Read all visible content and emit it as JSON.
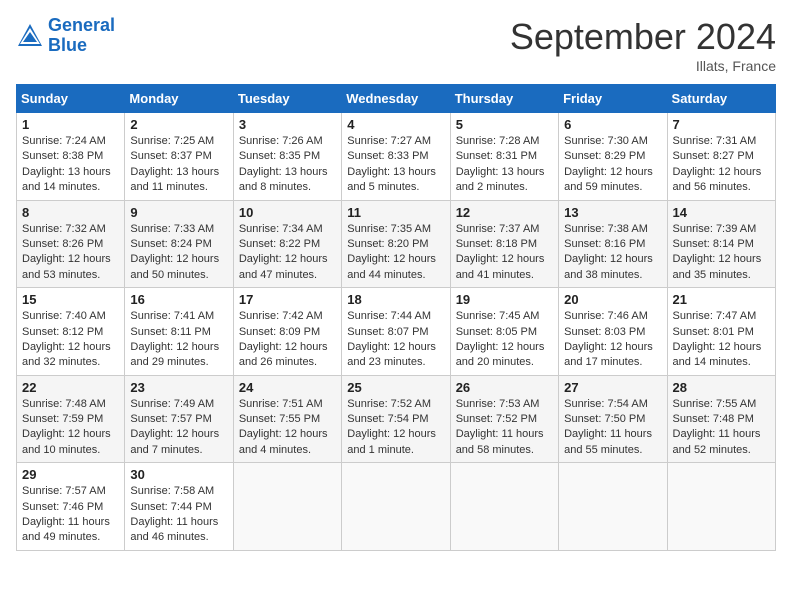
{
  "header": {
    "logo_general": "General",
    "logo_blue": "Blue",
    "month_title": "September 2024",
    "location": "Illats, France"
  },
  "days_of_week": [
    "Sunday",
    "Monday",
    "Tuesday",
    "Wednesday",
    "Thursday",
    "Friday",
    "Saturday"
  ],
  "weeks": [
    [
      {
        "day": "1",
        "lines": [
          "Sunrise: 7:24 AM",
          "Sunset: 8:38 PM",
          "Daylight: 13 hours",
          "and 14 minutes."
        ]
      },
      {
        "day": "2",
        "lines": [
          "Sunrise: 7:25 AM",
          "Sunset: 8:37 PM",
          "Daylight: 13 hours",
          "and 11 minutes."
        ]
      },
      {
        "day": "3",
        "lines": [
          "Sunrise: 7:26 AM",
          "Sunset: 8:35 PM",
          "Daylight: 13 hours",
          "and 8 minutes."
        ]
      },
      {
        "day": "4",
        "lines": [
          "Sunrise: 7:27 AM",
          "Sunset: 8:33 PM",
          "Daylight: 13 hours",
          "and 5 minutes."
        ]
      },
      {
        "day": "5",
        "lines": [
          "Sunrise: 7:28 AM",
          "Sunset: 8:31 PM",
          "Daylight: 13 hours",
          "and 2 minutes."
        ]
      },
      {
        "day": "6",
        "lines": [
          "Sunrise: 7:30 AM",
          "Sunset: 8:29 PM",
          "Daylight: 12 hours",
          "and 59 minutes."
        ]
      },
      {
        "day": "7",
        "lines": [
          "Sunrise: 7:31 AM",
          "Sunset: 8:27 PM",
          "Daylight: 12 hours",
          "and 56 minutes."
        ]
      }
    ],
    [
      {
        "day": "8",
        "lines": [
          "Sunrise: 7:32 AM",
          "Sunset: 8:26 PM",
          "Daylight: 12 hours",
          "and 53 minutes."
        ]
      },
      {
        "day": "9",
        "lines": [
          "Sunrise: 7:33 AM",
          "Sunset: 8:24 PM",
          "Daylight: 12 hours",
          "and 50 minutes."
        ]
      },
      {
        "day": "10",
        "lines": [
          "Sunrise: 7:34 AM",
          "Sunset: 8:22 PM",
          "Daylight: 12 hours",
          "and 47 minutes."
        ]
      },
      {
        "day": "11",
        "lines": [
          "Sunrise: 7:35 AM",
          "Sunset: 8:20 PM",
          "Daylight: 12 hours",
          "and 44 minutes."
        ]
      },
      {
        "day": "12",
        "lines": [
          "Sunrise: 7:37 AM",
          "Sunset: 8:18 PM",
          "Daylight: 12 hours",
          "and 41 minutes."
        ]
      },
      {
        "day": "13",
        "lines": [
          "Sunrise: 7:38 AM",
          "Sunset: 8:16 PM",
          "Daylight: 12 hours",
          "and 38 minutes."
        ]
      },
      {
        "day": "14",
        "lines": [
          "Sunrise: 7:39 AM",
          "Sunset: 8:14 PM",
          "Daylight: 12 hours",
          "and 35 minutes."
        ]
      }
    ],
    [
      {
        "day": "15",
        "lines": [
          "Sunrise: 7:40 AM",
          "Sunset: 8:12 PM",
          "Daylight: 12 hours",
          "and 32 minutes."
        ]
      },
      {
        "day": "16",
        "lines": [
          "Sunrise: 7:41 AM",
          "Sunset: 8:11 PM",
          "Daylight: 12 hours",
          "and 29 minutes."
        ]
      },
      {
        "day": "17",
        "lines": [
          "Sunrise: 7:42 AM",
          "Sunset: 8:09 PM",
          "Daylight: 12 hours",
          "and 26 minutes."
        ]
      },
      {
        "day": "18",
        "lines": [
          "Sunrise: 7:44 AM",
          "Sunset: 8:07 PM",
          "Daylight: 12 hours",
          "and 23 minutes."
        ]
      },
      {
        "day": "19",
        "lines": [
          "Sunrise: 7:45 AM",
          "Sunset: 8:05 PM",
          "Daylight: 12 hours",
          "and 20 minutes."
        ]
      },
      {
        "day": "20",
        "lines": [
          "Sunrise: 7:46 AM",
          "Sunset: 8:03 PM",
          "Daylight: 12 hours",
          "and 17 minutes."
        ]
      },
      {
        "day": "21",
        "lines": [
          "Sunrise: 7:47 AM",
          "Sunset: 8:01 PM",
          "Daylight: 12 hours",
          "and 14 minutes."
        ]
      }
    ],
    [
      {
        "day": "22",
        "lines": [
          "Sunrise: 7:48 AM",
          "Sunset: 7:59 PM",
          "Daylight: 12 hours",
          "and 10 minutes."
        ]
      },
      {
        "day": "23",
        "lines": [
          "Sunrise: 7:49 AM",
          "Sunset: 7:57 PM",
          "Daylight: 12 hours",
          "and 7 minutes."
        ]
      },
      {
        "day": "24",
        "lines": [
          "Sunrise: 7:51 AM",
          "Sunset: 7:55 PM",
          "Daylight: 12 hours",
          "and 4 minutes."
        ]
      },
      {
        "day": "25",
        "lines": [
          "Sunrise: 7:52 AM",
          "Sunset: 7:54 PM",
          "Daylight: 12 hours",
          "and 1 minute."
        ]
      },
      {
        "day": "26",
        "lines": [
          "Sunrise: 7:53 AM",
          "Sunset: 7:52 PM",
          "Daylight: 11 hours",
          "and 58 minutes."
        ]
      },
      {
        "day": "27",
        "lines": [
          "Sunrise: 7:54 AM",
          "Sunset: 7:50 PM",
          "Daylight: 11 hours",
          "and 55 minutes."
        ]
      },
      {
        "day": "28",
        "lines": [
          "Sunrise: 7:55 AM",
          "Sunset: 7:48 PM",
          "Daylight: 11 hours",
          "and 52 minutes."
        ]
      }
    ],
    [
      {
        "day": "29",
        "lines": [
          "Sunrise: 7:57 AM",
          "Sunset: 7:46 PM",
          "Daylight: 11 hours",
          "and 49 minutes."
        ]
      },
      {
        "day": "30",
        "lines": [
          "Sunrise: 7:58 AM",
          "Sunset: 7:44 PM",
          "Daylight: 11 hours",
          "and 46 minutes."
        ]
      },
      null,
      null,
      null,
      null,
      null
    ]
  ]
}
